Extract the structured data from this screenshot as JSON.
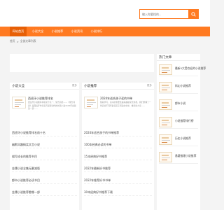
{
  "search": {
    "placeholder": "输入你要找的..."
  },
  "nav": {
    "items": [
      {
        "label": "网站首页",
        "active": true
      },
      {
        "label": "小说大全",
        "active": false
      },
      {
        "label": "小说推荐",
        "active": false
      },
      {
        "label": "小说资讯",
        "active": false
      },
      {
        "label": "小说排行",
        "active": false
      }
    ]
  },
  "breadcrumb": {
    "home": "首页",
    "sep": ">",
    "current": "全部文章列表"
  },
  "left": {
    "title": "小说大全",
    "more": "更多",
    "featured": {
      "title": "西班牙小说推荐排名",
      "desc": "西班牙小说推荐排名前十名一、堂吉诃德——《堂吉诃德》是西班牙作家塞万提斯创作的长篇小说1605年出版第一部……"
    },
    "list": [
      "西班牙小说推荐排名前十名",
      "幽默风趣搞笑文言小说",
      "描写成长的推荐书目",
      "金庸小说全集无删减版",
      "都市小说推荐必读书目",
      "金庸小说推荐看哪一部"
    ]
  },
  "mid": {
    "title": "小说推荐",
    "more": "更多",
    "featured": {
      "title": "2024年适合孩子读的书单",
      "desc": "随着学习，读书的重要性越来越被家长重视，我们整理了一份适合不同年龄段孩子阅读的书单，推荐给大家……"
    },
    "list": [
      "2024年适合孩子的书单推荐",
      "100本经典必读的书单",
      "15本经典好书推荐",
      "2022年最新好书推荐",
      "2022年推荐好书书单",
      "30本经典好书推荐下载"
    ]
  },
  "side": {
    "title": "热门文章",
    "items": [
      "最新5大受欢迎的小说推荐",
      "科幻小说推荐",
      "都市小说",
      "小说推荐排行榜",
      "历史小说推荐",
      "悬疑推理小说推荐"
    ]
  },
  "colors": {
    "accent": "#ff7a21",
    "accent_dark": "#e75f05"
  }
}
